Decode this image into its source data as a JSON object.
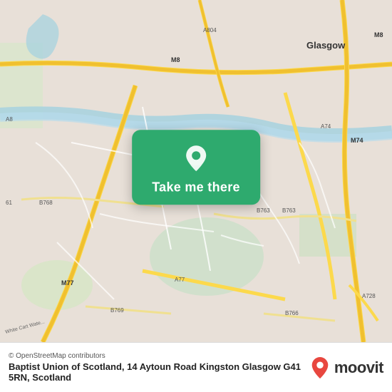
{
  "map": {
    "alt": "Map of Glasgow area showing Baptist Union of Scotland location"
  },
  "cta": {
    "button_label": "Take me there",
    "pin_alt": "location pin"
  },
  "footer": {
    "osm_credit": "© OpenStreetMap contributors",
    "place_name": "Baptist Union of Scotland, 14 Aytoun Road Kingston Glasgow G41 5RN, Scotland",
    "logo_text": "moovit"
  },
  "colors": {
    "map_green": "#2eaa6e",
    "road_yellow": "#f0d060",
    "road_major": "#fcd94c",
    "water": "#aad3df",
    "park": "#c8e6b0"
  }
}
